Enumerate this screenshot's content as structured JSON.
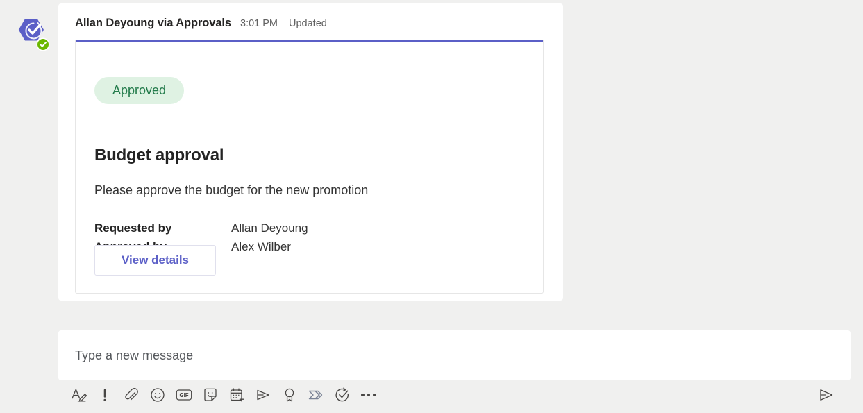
{
  "message": {
    "sender": "Allan Deyoung via Approvals",
    "time": "3:01 PM",
    "status": "Updated",
    "avatar_icon": "approvals-app-icon",
    "presence_icon": "available-badge-icon"
  },
  "card": {
    "accent_color": "#5b5fc7",
    "status_badge": {
      "label": "Approved",
      "background": "#dff2e3",
      "text_color": "#237b4b"
    },
    "title": "Budget approval",
    "description": "Please approve the budget for the new promotion",
    "facts": [
      {
        "title": "Requested by",
        "value": "Allan Deyoung"
      },
      {
        "title": "Approved by",
        "value": "Alex Wilber"
      }
    ],
    "action_label": "View details",
    "action_color": "#5b5fc7"
  },
  "compose": {
    "placeholder": "Type a new message",
    "value": "",
    "toolbar": [
      {
        "name": "format-icon",
        "label": "Format"
      },
      {
        "name": "importance-icon",
        "label": "Set delivery options"
      },
      {
        "name": "attach-icon",
        "label": "Attach"
      },
      {
        "name": "emoji-icon",
        "label": "Emoji"
      },
      {
        "name": "gif-icon",
        "label": "GIF"
      },
      {
        "name": "sticker-icon",
        "label": "Sticker"
      },
      {
        "name": "meeting-icon",
        "label": "Schedule a meeting"
      },
      {
        "name": "stream-icon",
        "label": "Stream"
      },
      {
        "name": "praise-icon",
        "label": "Praise"
      },
      {
        "name": "power-automate-icon",
        "label": "Power Automate"
      },
      {
        "name": "approvals-icon",
        "label": "Approvals"
      },
      {
        "name": "more-options-icon",
        "label": "More options"
      }
    ],
    "send_label": "Send",
    "gif_label": "GIF"
  }
}
